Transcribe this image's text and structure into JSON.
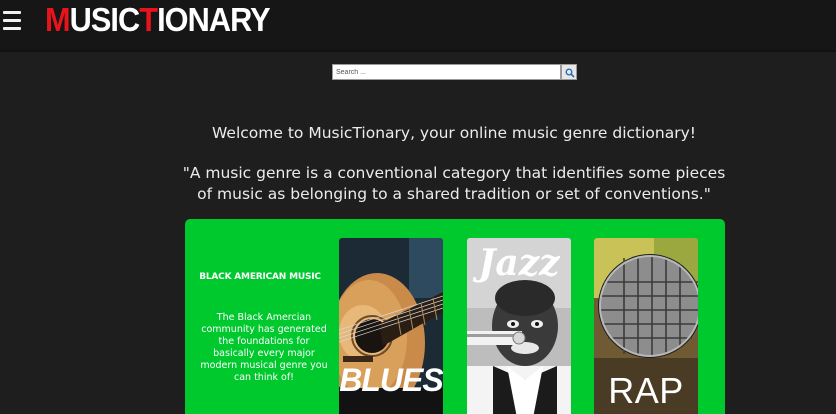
{
  "header": {
    "logo_parts": [
      {
        "text": "M",
        "color": "#e8141c"
      },
      {
        "text": "USIC",
        "color": "#ffffff"
      },
      {
        "text": "T",
        "color": "#e8141c"
      },
      {
        "text": "IONARY",
        "color": "#ffffff"
      }
    ],
    "menu_icon": "hamburger-menu-icon"
  },
  "search": {
    "placeholder": "Search ...",
    "value": "",
    "button_icon": "magnifier-icon"
  },
  "main": {
    "welcome": "Welcome to MusicTionary, your online music genre dictionary!",
    "quote": "\"A music genre is a conventional category that identifies some pieces of music as belonging to a shared tradition or set of conventions.\""
  },
  "section": {
    "title": "BLACK AMERICAN MUSIC",
    "text": "The Black Amercian community has generated the foundations for basically every major modern musical genre you can think of!",
    "background": "#00c92e"
  },
  "genres": [
    {
      "label": "BLUES"
    },
    {
      "label": "Jazz"
    },
    {
      "label": "RAP"
    }
  ]
}
